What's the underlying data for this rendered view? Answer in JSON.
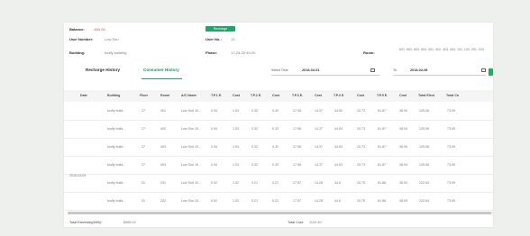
{
  "header": {
    "balance_label": "Balance:",
    "balance_value": "-490.26",
    "recharge_button": "Recharge",
    "user_number_label": "User Number:",
    "user_number_value": "Low Son",
    "user_no_label": "User No.:",
    "user_no_value": "13",
    "building_label": "Building:",
    "building_value": "toolfy building",
    "phase_label": "Phase:",
    "phase_value": "17-24-20 49-20",
    "room_label": "Room:",
    "room_value": "601, 602, 603, 604, 401, 402, 403, 404, 101, 102, 201, 204"
  },
  "tabs": [
    {
      "label": "Recharge History",
      "active": false
    },
    {
      "label": "Consumer History",
      "active": true
    }
  ],
  "filter": {
    "start_label": "Select Time",
    "start_value": "2018-02-01",
    "to_label": "To",
    "end_value": "2018-02-08"
  },
  "table": {
    "columns": [
      "Date",
      "Building",
      "Floor",
      "Room",
      "A/C Name",
      "T.P.1 E.",
      "Cost",
      "T.P.2 E.",
      "Cost",
      "T.P.3 E.",
      "Cost",
      "T.P.4 E.",
      "Cost",
      "T.P.5 E.",
      "Cost",
      "Total Elect",
      "Total Co"
    ],
    "date_group": "2018-02-09",
    "rows": [
      [
        "toolfy build...",
        "27",
        "401",
        "Low Son 10...",
        "0.94",
        "1.03",
        "0.32",
        "0.32",
        "17.56",
        "14.37",
        "44.53",
        "20.73",
        "61.87",
        "38.94",
        "125.06",
        "73.49"
      ],
      [
        "toolfy build...",
        "27",
        "402",
        "Low Son 10...",
        "0.94",
        "1.03",
        "0.32",
        "0.32",
        "17.56",
        "14.37",
        "44.53",
        "20.73",
        "61.87",
        "38.94",
        "125.06",
        "73.49"
      ],
      [
        "toolfy build...",
        "27",
        "403",
        "Low Son 10...",
        "0.94",
        "1.03",
        "0.32",
        "0.32",
        "17.56",
        "14.37",
        "44.53",
        "20.73",
        "61.87",
        "38.94",
        "125.06",
        "73.49"
      ],
      [
        "toolfy build...",
        "27",
        "404",
        "Low Son 10...",
        "0.94",
        "1.03",
        "0.32",
        "0.32",
        "17.56",
        "14.37",
        "44.53",
        "20.73",
        "61.87",
        "38.94",
        "125.06",
        "73.49"
      ],
      [
        "toolfy build...",
        "31",
        "201",
        "Low Son 10...",
        "0.92",
        "1.02",
        "0.21",
        "0.21",
        "17.57",
        "14.28",
        "44.6",
        "20.75",
        "61.86",
        "38.93",
        "122.64",
        "73.49"
      ],
      [
        "toolfy build...",
        "31",
        "202",
        "Low Son 10...",
        "0.92",
        "1.02",
        "0.21",
        "0.21",
        "17.57",
        "14.28",
        "44.6",
        "20.75",
        "61.86",
        "38.93",
        "122.64",
        "73.49"
      ]
    ]
  },
  "footer": {
    "total_elec_label": "Total Electricity(kWh):",
    "total_elec_value": "8085.02",
    "total_cost_label": "Total Cost:",
    "total_cost_value": "1102.30"
  },
  "colors": {
    "accent": "#1fa46a",
    "background": "#eef0ee"
  }
}
